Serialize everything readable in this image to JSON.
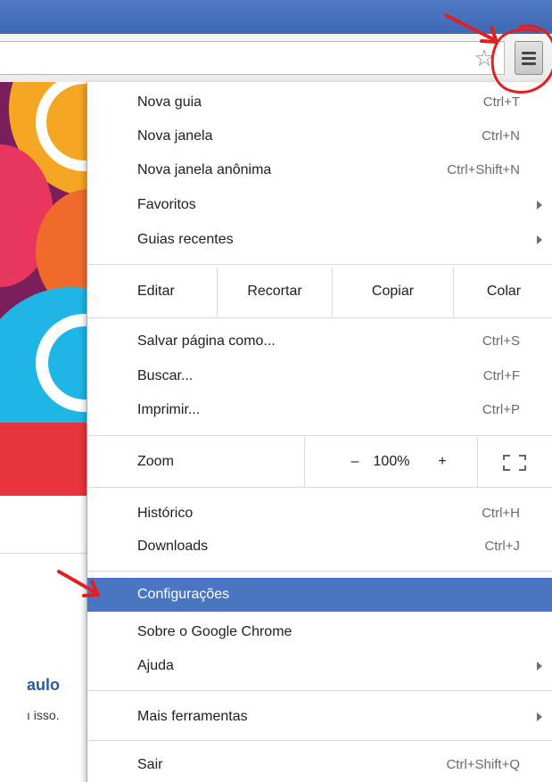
{
  "menu": {
    "items_top": [
      {
        "label": "Nova guia",
        "shortcut": "Ctrl+T"
      },
      {
        "label": "Nova janela",
        "shortcut": "Ctrl+N"
      },
      {
        "label": "Nova janela anônima",
        "shortcut": "Ctrl+Shift+N"
      },
      {
        "label": "Favoritos",
        "shortcut": ""
      },
      {
        "label": "Guias recentes",
        "shortcut": ""
      }
    ],
    "edit": {
      "label": "Editar",
      "cut": "Recortar",
      "copy": "Copiar",
      "paste": "Colar"
    },
    "items_mid": [
      {
        "label": "Salvar página como...",
        "shortcut": "Ctrl+S"
      },
      {
        "label": "Buscar...",
        "shortcut": "Ctrl+F"
      },
      {
        "label": "Imprimir...",
        "shortcut": "Ctrl+P"
      }
    ],
    "zoom": {
      "label": "Zoom",
      "minus": "–",
      "value": "100%",
      "plus": "+"
    },
    "items_hist": [
      {
        "label": "Histórico",
        "shortcut": "Ctrl+H"
      },
      {
        "label": "Downloads",
        "shortcut": "Ctrl+J"
      }
    ],
    "items_settings": [
      {
        "label": "Configurações"
      },
      {
        "label": "Sobre o Google Chrome"
      },
      {
        "label": "Ajuda"
      }
    ],
    "more_tools": {
      "label": "Mais ferramentas"
    },
    "exit": {
      "label": "Sair",
      "shortcut": "Ctrl+Shift+Q"
    }
  },
  "page": {
    "title_fragment": "aulo",
    "text_fragment": "ı isso."
  },
  "colors": {
    "highlight": "#4a75c2",
    "annotation": "#e02020",
    "titlebar": "#4470bd"
  },
  "icons": {
    "bookmark": "star-icon",
    "menu": "hamburger-icon"
  }
}
